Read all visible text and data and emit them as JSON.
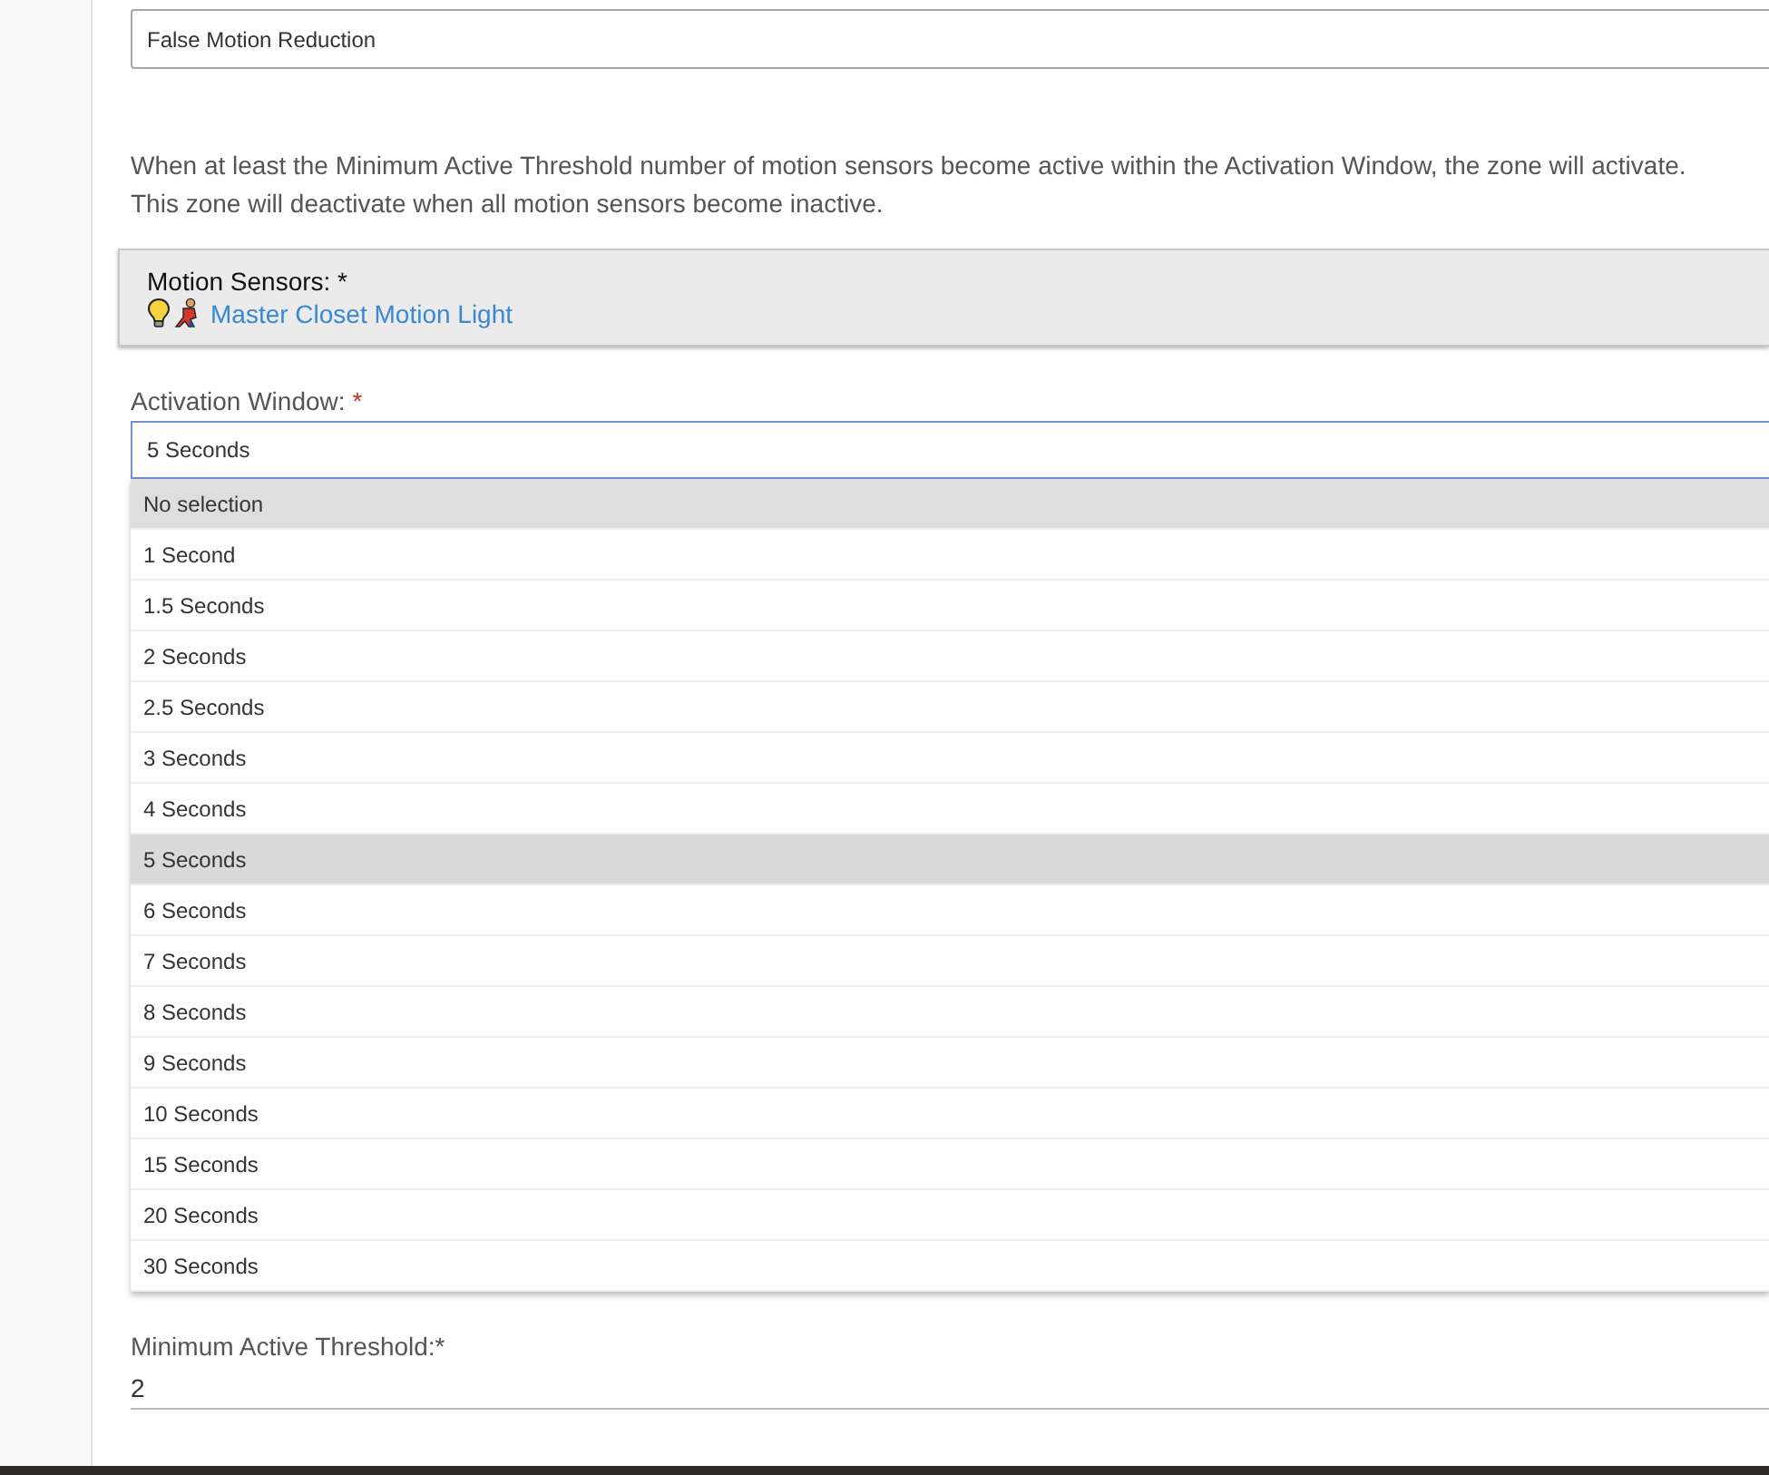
{
  "zone_type_field": {
    "value": "False Motion Reduction"
  },
  "description": [
    "When at least the Minimum Active Threshold number of motion sensors become active within the Activation Window, the zone will activate.",
    "This zone will deactivate when all motion sensors become inactive."
  ],
  "motion_sensors": {
    "label": "Motion Sensors: *",
    "devices": [
      {
        "name": "Master Closet Motion Light"
      }
    ]
  },
  "activation_window": {
    "label": "Activation Window:",
    "required_mark": "*",
    "value": "5 Seconds",
    "options": [
      {
        "label": "No selection",
        "selected": false,
        "highlighted": true
      },
      {
        "label": "1 Second",
        "selected": false,
        "highlighted": false
      },
      {
        "label": "1.5 Seconds",
        "selected": false,
        "highlighted": false
      },
      {
        "label": "2 Seconds",
        "selected": false,
        "highlighted": false
      },
      {
        "label": "2.5 Seconds",
        "selected": false,
        "highlighted": false
      },
      {
        "label": "3 Seconds",
        "selected": false,
        "highlighted": false
      },
      {
        "label": "4 Seconds",
        "selected": false,
        "highlighted": false
      },
      {
        "label": "5 Seconds",
        "selected": true,
        "highlighted": false
      },
      {
        "label": "6 Seconds",
        "selected": false,
        "highlighted": false
      },
      {
        "label": "7 Seconds",
        "selected": false,
        "highlighted": false
      },
      {
        "label": "8 Seconds",
        "selected": false,
        "highlighted": false
      },
      {
        "label": "9 Seconds",
        "selected": false,
        "highlighted": false
      },
      {
        "label": "10 Seconds",
        "selected": false,
        "highlighted": false
      },
      {
        "label": "15 Seconds",
        "selected": false,
        "highlighted": false
      },
      {
        "label": "20 Seconds",
        "selected": false,
        "highlighted": false
      },
      {
        "label": "30 Seconds",
        "selected": false,
        "highlighted": false
      }
    ]
  },
  "minimum_active_threshold": {
    "label": "Minimum Active Threshold:*",
    "value": "2"
  }
}
